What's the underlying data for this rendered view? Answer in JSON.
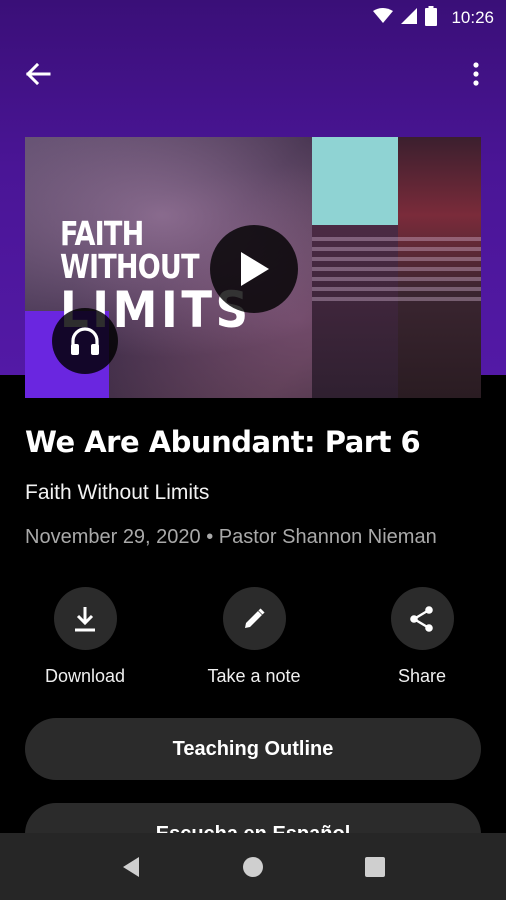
{
  "status_bar": {
    "time": "10:26"
  },
  "hero": {
    "title_line1": "FAITH WITHOUT",
    "title_line2": "LIMITS"
  },
  "message": {
    "title": "We Are Abundant: Part 6",
    "series": "Faith Without Limits",
    "meta": "November 29, 2020 • Pastor Shannon Nieman"
  },
  "actions": [
    {
      "label": "Download",
      "icon": "download-icon"
    },
    {
      "label": "Take a note",
      "icon": "pencil-icon"
    },
    {
      "label": "Share",
      "icon": "share-icon"
    }
  ],
  "buttons": {
    "teaching_outline": "Teaching Outline",
    "spanish": "Escucha en Español"
  },
  "colors": {
    "accent": "#6a26e0",
    "header_purple": "#4a1596",
    "surface": "#2b2b2b"
  }
}
